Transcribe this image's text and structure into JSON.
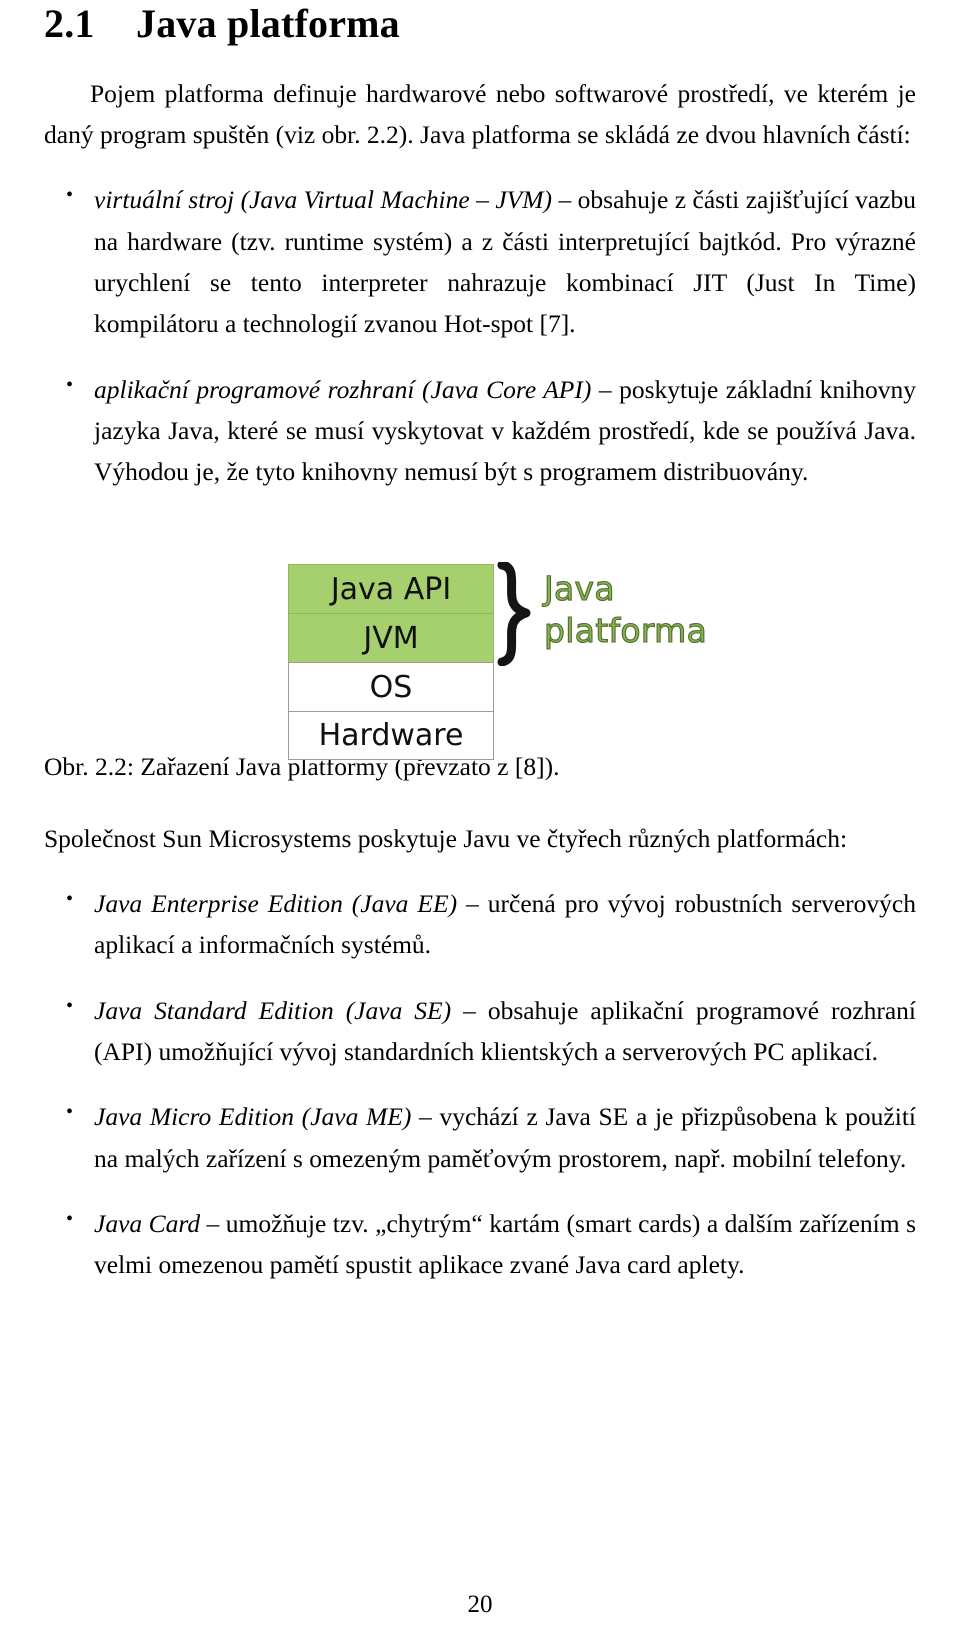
{
  "document": {
    "page_number": "20",
    "section": {
      "number": "2.1",
      "title": "Java platforma"
    }
  },
  "intro_paragraph": "Pojem platforma definuje hardwarové nebo softwarové prostředí, ve kterém je daný program spuštěn (viz obr. 2.2). Java platforma se skládá ze dvou hlavních částí:",
  "main_bullets": [
    {
      "term": "virtuální stroj (Java Virtual Machine – JVM)",
      "text": " – obsahuje z části zajišťující vazbu na hardware (tzv. runtime systém) a z části interpretující bajtkód. Pro výrazné urychlení se tento interpreter nahrazuje kombinací JIT (Just In Time) kompilátoru a technologií zvanou Hot-spot [7]."
    },
    {
      "term": "aplikační programové rozhraní (Java Core API)",
      "text": " – poskytuje základní knihovny jazyka Java, které se musí vyskytovat v každém prostředí, kde se používá Java. Výhodou je, že tyto knihovny nemusí být s programem distribuovány."
    }
  ],
  "figure": {
    "stack_rows": [
      {
        "label": "Java API",
        "highlighted": true
      },
      {
        "label": "JVM",
        "highlighted": true
      },
      {
        "label": "OS",
        "highlighted": false
      },
      {
        "label": "Hardware",
        "highlighted": false
      }
    ],
    "brace_glyph": "}",
    "platform_label_line1": "Java",
    "platform_label_line2": "platforma",
    "colors": {
      "highlight_fill": "#a6cf6e",
      "box_border": "#9c9c9c",
      "label_text": "#8bb551",
      "label_outline": "#4d6b2c"
    },
    "caption": "Obr. 2.2: Zařazení Java platformy (převzato z [8])."
  },
  "sun_paragraph": "Společnost Sun Microsystems poskytuje Javu ve čtyřech různých platformách:",
  "platform_bullets": [
    {
      "term": "Java Enterprise Edition (Java EE)",
      "text": " – určená pro vývoj robustních serverových aplikací a informačních systémů."
    },
    {
      "term": "Java Standard Edition (Java SE)",
      "text": " – obsahuje aplikační programové rozhraní (API) umožňující vývoj standardních klientských a serverových PC aplikací."
    },
    {
      "term": "Java Micro Edition (Java ME)",
      "text": " – vychází z Java SE a je přizpůsobena k použití na malých zařízení s omezeným paměťovým prostorem, např. mobilní telefony."
    },
    {
      "term": "Java Card",
      "text": " – umožňuje tzv. „chytrým“ kartám (smart cards) a dalším zařízením s velmi omezenou pamětí spustit aplikace zvané Java card aplety."
    }
  ]
}
